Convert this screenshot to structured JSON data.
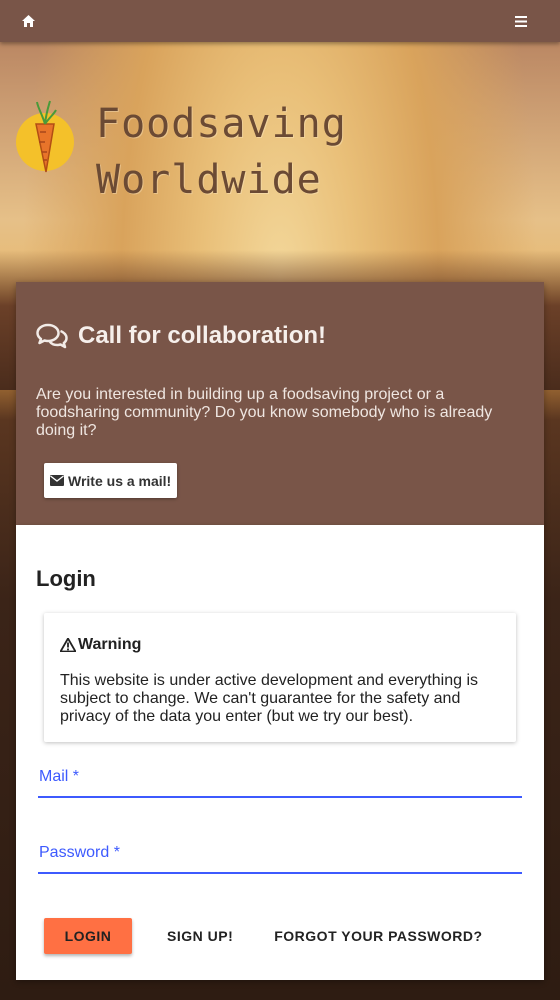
{
  "topbar": {
    "home_icon": "home-icon",
    "menu_icon": "hamburger-menu-icon",
    "color": "#795548"
  },
  "logo": {
    "line1": "Foodsaving",
    "line2": "Worldwide",
    "icon": "carrot-logo-icon"
  },
  "collab": {
    "icon": "comments-icon",
    "title": "Call for collaboration!",
    "text": "Are you interested in building up a foodsaving project or a foodsharing community? Do you know somebody who is already doing it?",
    "mail_button_icon": "envelope-icon",
    "mail_button_label": "Write us a mail!"
  },
  "login": {
    "title": "Login",
    "warning": {
      "icon": "warning-triangle-icon",
      "heading": "Warning",
      "text": "This website is under active development and everything is subject to change. We can't guarantee for the safety and privacy of the data you enter (but we try our best)."
    },
    "mail_label": "Mail *",
    "password_label": "Password *",
    "login_button": "LOGIN",
    "signup_button": "SIGN UP!",
    "forgot_button": "FORGOT YOUR PASSWORD?",
    "accent_color": "#3d5afe",
    "login_button_color": "#ff7043"
  }
}
